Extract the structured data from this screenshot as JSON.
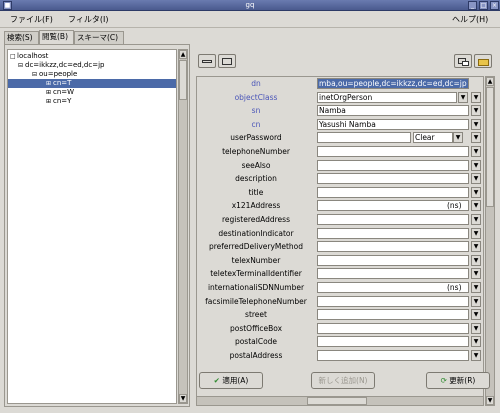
{
  "window": {
    "title": "gq"
  },
  "menubar": {
    "file": "ファイル(F)",
    "filter": "フィルタ(I)",
    "help": "ヘルプ(H)"
  },
  "tabs": [
    {
      "label": "検索(S)"
    },
    {
      "label": "閲覧(B)"
    },
    {
      "label": "スキーマ(C)"
    }
  ],
  "tree": [
    "localhost",
    "dc=ikkzz,dc=ed,dc=jp",
    "ou=people",
    "cn=T",
    "cn=W",
    "cn=Y"
  ],
  "attributes": [
    {
      "label": "dn",
      "value": "mba,ou=people,dc=ikkzz,dc=ed,dc=jp"
    },
    {
      "label": "objectClass",
      "value": "inetOrgPerson"
    },
    {
      "label": "sn",
      "value": "Namba"
    },
    {
      "label": "cn",
      "value": "Yasushi Namba"
    },
    {
      "label": "userPassword",
      "value": "",
      "option": "Clear"
    },
    {
      "label": "telephoneNumber",
      "value": ""
    },
    {
      "label": "seeAlso",
      "value": ""
    },
    {
      "label": "description",
      "value": ""
    },
    {
      "label": "title",
      "value": ""
    },
    {
      "label": "x121Address",
      "value": "",
      "suffix": "(ns)"
    },
    {
      "label": "registeredAddress",
      "value": ""
    },
    {
      "label": "destinationIndicator",
      "value": ""
    },
    {
      "label": "preferredDeliveryMethod",
      "value": ""
    },
    {
      "label": "telexNumber",
      "value": ""
    },
    {
      "label": "teletexTerminalIdentifier",
      "value": ""
    },
    {
      "label": "internationaliSDNNumber",
      "value": "",
      "suffix": "(ns)"
    },
    {
      "label": "facsimileTelephoneNumber",
      "value": ""
    },
    {
      "label": "street",
      "value": ""
    },
    {
      "label": "postOfficeBox",
      "value": ""
    },
    {
      "label": "postalCode",
      "value": ""
    },
    {
      "label": "postalAddress",
      "value": ""
    }
  ],
  "buttons": {
    "apply": "適用(A)",
    "add_new": "新しく追加(N)",
    "refresh": "更新(R)"
  },
  "colors": {
    "selection": "#4b6aa8",
    "required_attr": "#4a55b8",
    "titlebar": "#4a5a8e"
  }
}
